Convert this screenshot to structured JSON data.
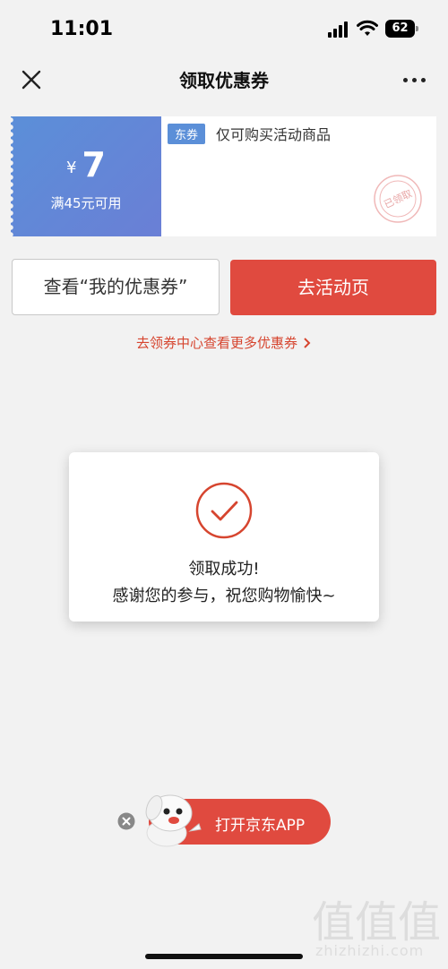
{
  "status_bar": {
    "time": "11:01",
    "battery": "62"
  },
  "nav": {
    "title": "领取优惠券",
    "close_icon": "close-icon",
    "more_icon": "more-icon"
  },
  "coupon": {
    "currency": "¥",
    "amount": "7",
    "condition": "满45元可用",
    "tag": "东券",
    "description": "仅可购买活动商品",
    "stamp": "已领取",
    "colors": {
      "gradient_start": "#5b8fd8",
      "gradient_end": "#6a7fd6"
    }
  },
  "actions": {
    "my_coupons_label": "查看“我的优惠券”",
    "activity_label": "去活动页",
    "center_link_label": "去领券中心查看更多优惠券"
  },
  "dialog": {
    "icon": "check-circle-icon",
    "title": "领取成功!",
    "message": "感谢您的参与，祝您购物愉快~"
  },
  "app_banner": {
    "label": "打开京东APP",
    "mascot_icon": "mascot-icon",
    "dismiss_icon": "close-circle-icon"
  },
  "watermark": {
    "logo": "值值值",
    "text": "zhizhizhi.com"
  },
  "colors": {
    "accent_red": "#e04a3f",
    "link_red": "#d6452f",
    "background": "#f2f2f2"
  }
}
